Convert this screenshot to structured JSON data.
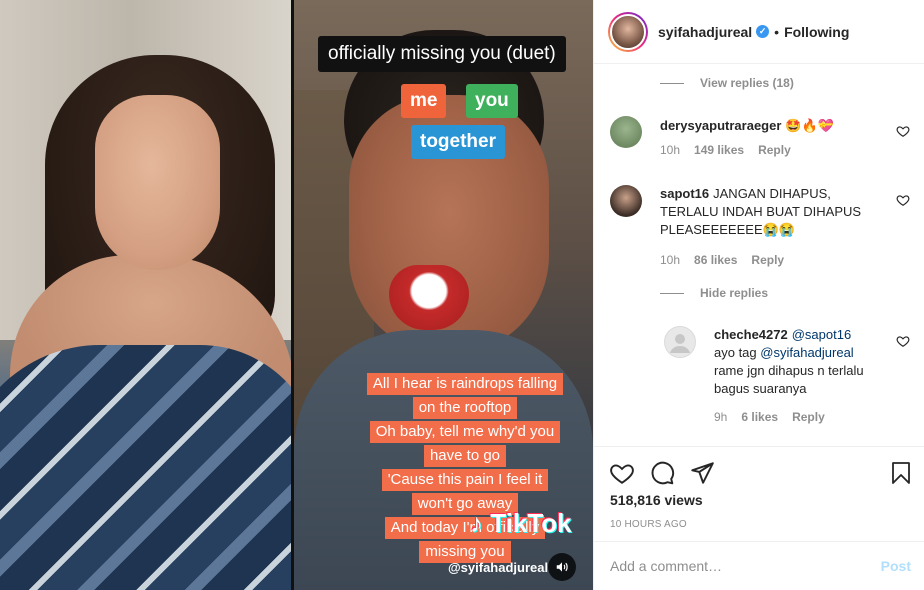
{
  "video": {
    "title": "officially missing you (duet)",
    "tags": [
      "me",
      "you",
      "together"
    ],
    "lyrics": [
      "All I hear is raindrops falling",
      "on the rooftop",
      "Oh baby, tell me why'd you",
      "have to go",
      "'Cause this pain I feel it",
      "won't go away",
      "And today I'm officially",
      "missing you"
    ],
    "watermark": "TikTok",
    "watermark_user": "@syifahadjureal"
  },
  "header": {
    "username": "syifahadjureal",
    "verified": true,
    "separator": "•",
    "follow_status": "Following"
  },
  "comments": {
    "view_replies": "View replies (18)",
    "items": [
      {
        "username": "derysyaputraraeger",
        "text": "🤩🔥💝",
        "time": "10h",
        "likes": "149 likes",
        "reply": "Reply"
      },
      {
        "username": "sapot16",
        "text": "JANGAN DIHAPUS, TERLALU INDAH BUAT DIHAPUS PLEASEEEEEEE😭😭",
        "time": "10h",
        "likes": "86 likes",
        "reply": "Reply"
      }
    ],
    "hide_replies": "Hide replies",
    "reply_item": {
      "username": "cheche4272",
      "mention1": "@sapot16",
      "prefix": "ayo tag",
      "mention2": "@syifahadjureal",
      "suffix": "rame jgn dihapus n terlalu bagus suaranya",
      "time": "9h",
      "likes": "6 likes",
      "reply": "Reply"
    }
  },
  "actions": {
    "views": "518,816 views",
    "timestamp": "10 HOURS AGO"
  },
  "add_comment": {
    "placeholder": "Add a comment…",
    "post_label": "Post"
  },
  "colors": {
    "link": "#00376b",
    "muted": "#8e8e8e",
    "post_disabled": "#b2dffc",
    "verified": "#3897f0"
  }
}
